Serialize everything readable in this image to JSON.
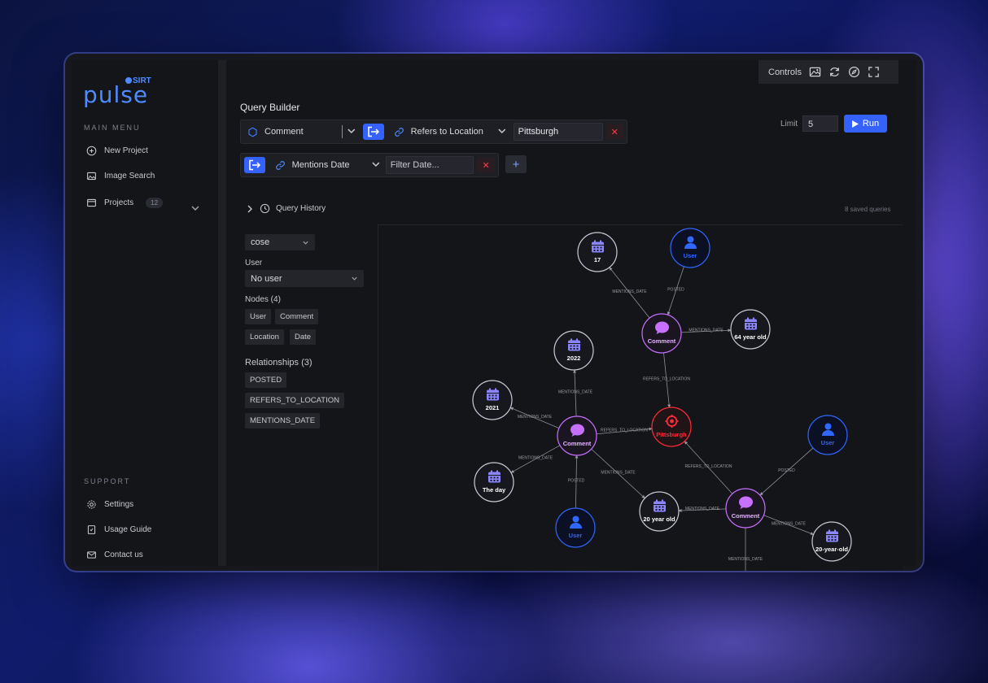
{
  "app": {
    "brand": "pulse",
    "brand_sub": "SIRT"
  },
  "sidebar": {
    "main_menu_label": "MAIN MENU",
    "items": [
      {
        "label": "New Project",
        "icon": "plus-circle-icon"
      },
      {
        "label": "Image Search",
        "icon": "image-icon"
      },
      {
        "label": "Projects",
        "icon": "folder-icon",
        "count": "12"
      }
    ],
    "support_label": "SUPPORT",
    "support_items": [
      {
        "label": "Settings",
        "icon": "gear-icon"
      },
      {
        "label": "Usage Guide",
        "icon": "book-icon"
      },
      {
        "label": "Contact us",
        "icon": "mail-icon"
      }
    ]
  },
  "header": {
    "controls_label": "Controls"
  },
  "query": {
    "title": "Query Builder",
    "row1": {
      "node_type": "Comment",
      "relation": "Refers to Location",
      "value": "Pittsburgh"
    },
    "row2": {
      "relation": "Mentions Date",
      "placeholder": "Filter Date..."
    },
    "limit_label": "Limit",
    "limit_value": "5",
    "run_label": "Run",
    "history_label": "Query History",
    "saved_count": "8 saved queries"
  },
  "panel": {
    "layout": "cose",
    "user_label": "User",
    "user_value": "No user",
    "nodes_label": "Nodes (4)",
    "nodes": [
      "User",
      "Comment",
      "Location",
      "Date"
    ],
    "relationships_label": "Relationships (3)",
    "relationships": [
      "POSTED",
      "REFERS_TO_LOCATION",
      "MENTIONS_DATE"
    ]
  },
  "colors": {
    "accent": "#3562ff",
    "date": "#8b86ff",
    "user": "#2f67ff",
    "comment": "#c770ff",
    "location": "#ff2b38"
  },
  "graph": {
    "nodes": [
      {
        "id": "d17",
        "type": "date",
        "label": "17"
      },
      {
        "id": "u1",
        "type": "user",
        "label": "User"
      },
      {
        "id": "c1",
        "type": "comment",
        "label": "Comment"
      },
      {
        "id": "d64",
        "type": "date",
        "label": "64 year old"
      },
      {
        "id": "d2022",
        "type": "date",
        "label": "2022"
      },
      {
        "id": "d2021",
        "type": "date",
        "label": "2021"
      },
      {
        "id": "c2",
        "type": "comment",
        "label": "Comment"
      },
      {
        "id": "loc",
        "type": "location",
        "label": "Pittsburgh"
      },
      {
        "id": "dday",
        "type": "date",
        "label": "The day"
      },
      {
        "id": "u2",
        "type": "user",
        "label": "User"
      },
      {
        "id": "d20",
        "type": "date",
        "label": "20 year old"
      },
      {
        "id": "c3",
        "type": "comment",
        "label": "Comment"
      },
      {
        "id": "u3",
        "type": "user",
        "label": "User"
      },
      {
        "id": "d20b",
        "type": "date",
        "label": "20-year-old"
      }
    ],
    "edges": [
      {
        "from": "c1",
        "to": "d17",
        "label": "MENTIONS_DATE"
      },
      {
        "from": "u1",
        "to": "c1",
        "label": "POSTED"
      },
      {
        "from": "c1",
        "to": "d64",
        "label": "MENTIONS_DATE"
      },
      {
        "from": "c1",
        "to": "loc",
        "label": "REFERS_TO_LOCATION"
      },
      {
        "from": "c2",
        "to": "d2022",
        "label": "MENTIONS_DATE"
      },
      {
        "from": "c2",
        "to": "d2021",
        "label": "MENTIONS_DATE"
      },
      {
        "from": "c2",
        "to": "loc",
        "label": "REFERS_TO_LOCATION"
      },
      {
        "from": "c2",
        "to": "dday",
        "label": "MENTIONS_DATE"
      },
      {
        "from": "u2",
        "to": "c2",
        "label": "POSTED"
      },
      {
        "from": "c2",
        "to": "d20",
        "label": "MENTIONS_DATE"
      },
      {
        "from": "c3",
        "to": "d20",
        "label": "MENTIONS_DATE"
      },
      {
        "from": "c3",
        "to": "loc",
        "label": "REFERS_TO_LOCATION"
      },
      {
        "from": "u3",
        "to": "c3",
        "label": "POSTED"
      },
      {
        "from": "c3",
        "to": "d20b",
        "label": "MENTIONS_DATE"
      },
      {
        "from": "c3",
        "to": null,
        "label": "MENTIONS_DATE"
      }
    ]
  }
}
